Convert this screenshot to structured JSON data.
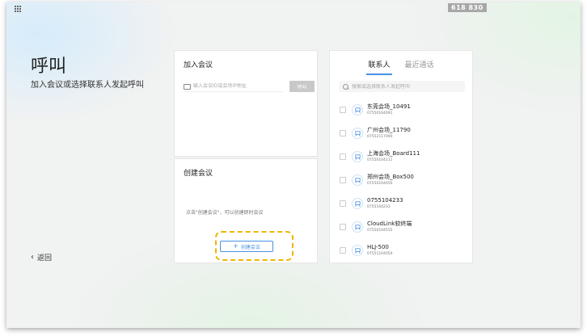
{
  "topbar": {
    "grid_icon": "apps-grid-icon",
    "meeting_id": "618 830"
  },
  "page": {
    "title": "呼叫",
    "subtitle": "加入会议或选择联系人发起呼叫",
    "back_label": "返回"
  },
  "join_meeting": {
    "title": "加入会议",
    "input_placeholder": "输入会议ID或会场IP地址",
    "call_label": "呼叫"
  },
  "create_meeting": {
    "title": "创建会议",
    "hint": "点击\"创建会议\"，可以创建即时会议",
    "button_label": "创建会议"
  },
  "contacts": {
    "tabs": [
      {
        "label": "联系人",
        "active": true
      },
      {
        "label": "最近通话",
        "active": false
      }
    ],
    "search_placeholder": "搜索或选择联系人发起呼叫",
    "items": [
      {
        "name": "东莞会场_10491",
        "number": "07550104091"
      },
      {
        "name": "广州会场_11790",
        "number": "07552117090"
      },
      {
        "name": "上海会场_Board111",
        "number": "07550104111"
      },
      {
        "name": "郑州会场_Box500",
        "number": "07550104050"
      },
      {
        "name": "0755104233",
        "number": "0755104233"
      },
      {
        "name": "CloudLink软终端",
        "number": "07550104555"
      },
      {
        "name": "HLJ-500",
        "number": "07551104050"
      }
    ]
  },
  "colors": {
    "accent": "#4a90e2",
    "highlight": "#f0b400"
  }
}
